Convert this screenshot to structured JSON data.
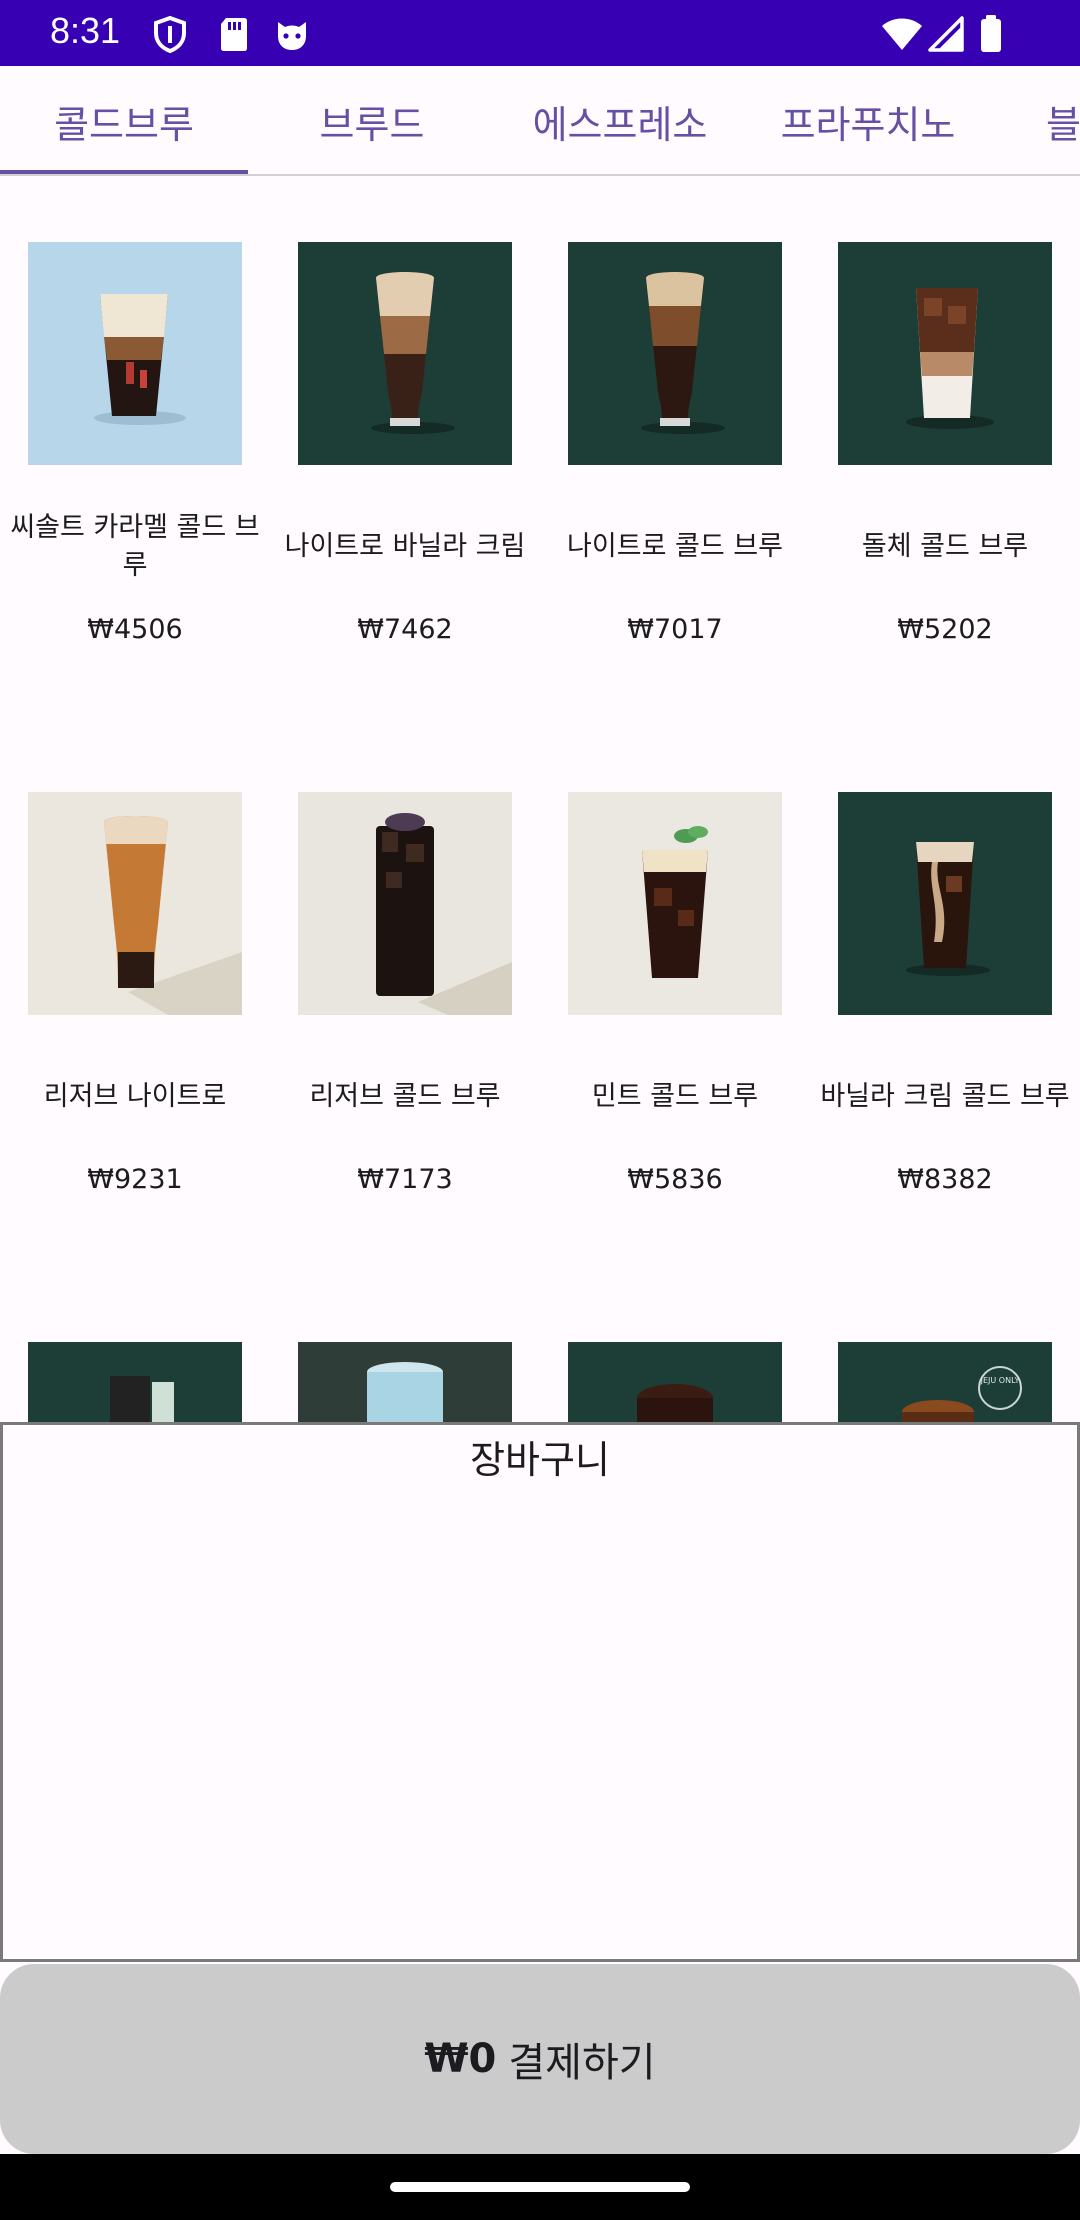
{
  "status_bar": {
    "time": "8:31",
    "background": "#3700b3",
    "icons": [
      "shield-icon",
      "sd-card-icon",
      "cat-face-icon",
      "wifi-icon",
      "cell-signal-icon",
      "battery-icon"
    ]
  },
  "tabs": {
    "items": [
      {
        "label": "콜드브루",
        "selected": true
      },
      {
        "label": "브루드",
        "selected": false
      },
      {
        "label": "에스프레소",
        "selected": false
      },
      {
        "label": "프라푸치노",
        "selected": false
      },
      {
        "label": "블",
        "selected": false
      }
    ],
    "accent": "#6750a4"
  },
  "products": [
    {
      "name": "씨솔트 카라멜 콜드 브루",
      "price": "₩4506"
    },
    {
      "name": "나이트로 바닐라 크림",
      "price": "₩7462"
    },
    {
      "name": "나이트로 콜드 브루",
      "price": "₩7017"
    },
    {
      "name": "돌체 콜드 브루",
      "price": "₩5202"
    },
    {
      "name": "리저브 나이트로",
      "price": "₩9231"
    },
    {
      "name": "리저브 콜드 브루",
      "price": "₩7173"
    },
    {
      "name": "민트 콜드 브루",
      "price": "₩5836"
    },
    {
      "name": "바닐라 크림 콜드 브루",
      "price": "₩8382"
    }
  ],
  "partial_products": [
    {
      "badge": ""
    },
    {
      "badge": ""
    },
    {
      "badge": ""
    },
    {
      "badge": "JEJU ONLY"
    }
  ],
  "cart": {
    "title": "장바구니"
  },
  "checkout": {
    "amount": "₩0",
    "label": "결제하기"
  }
}
